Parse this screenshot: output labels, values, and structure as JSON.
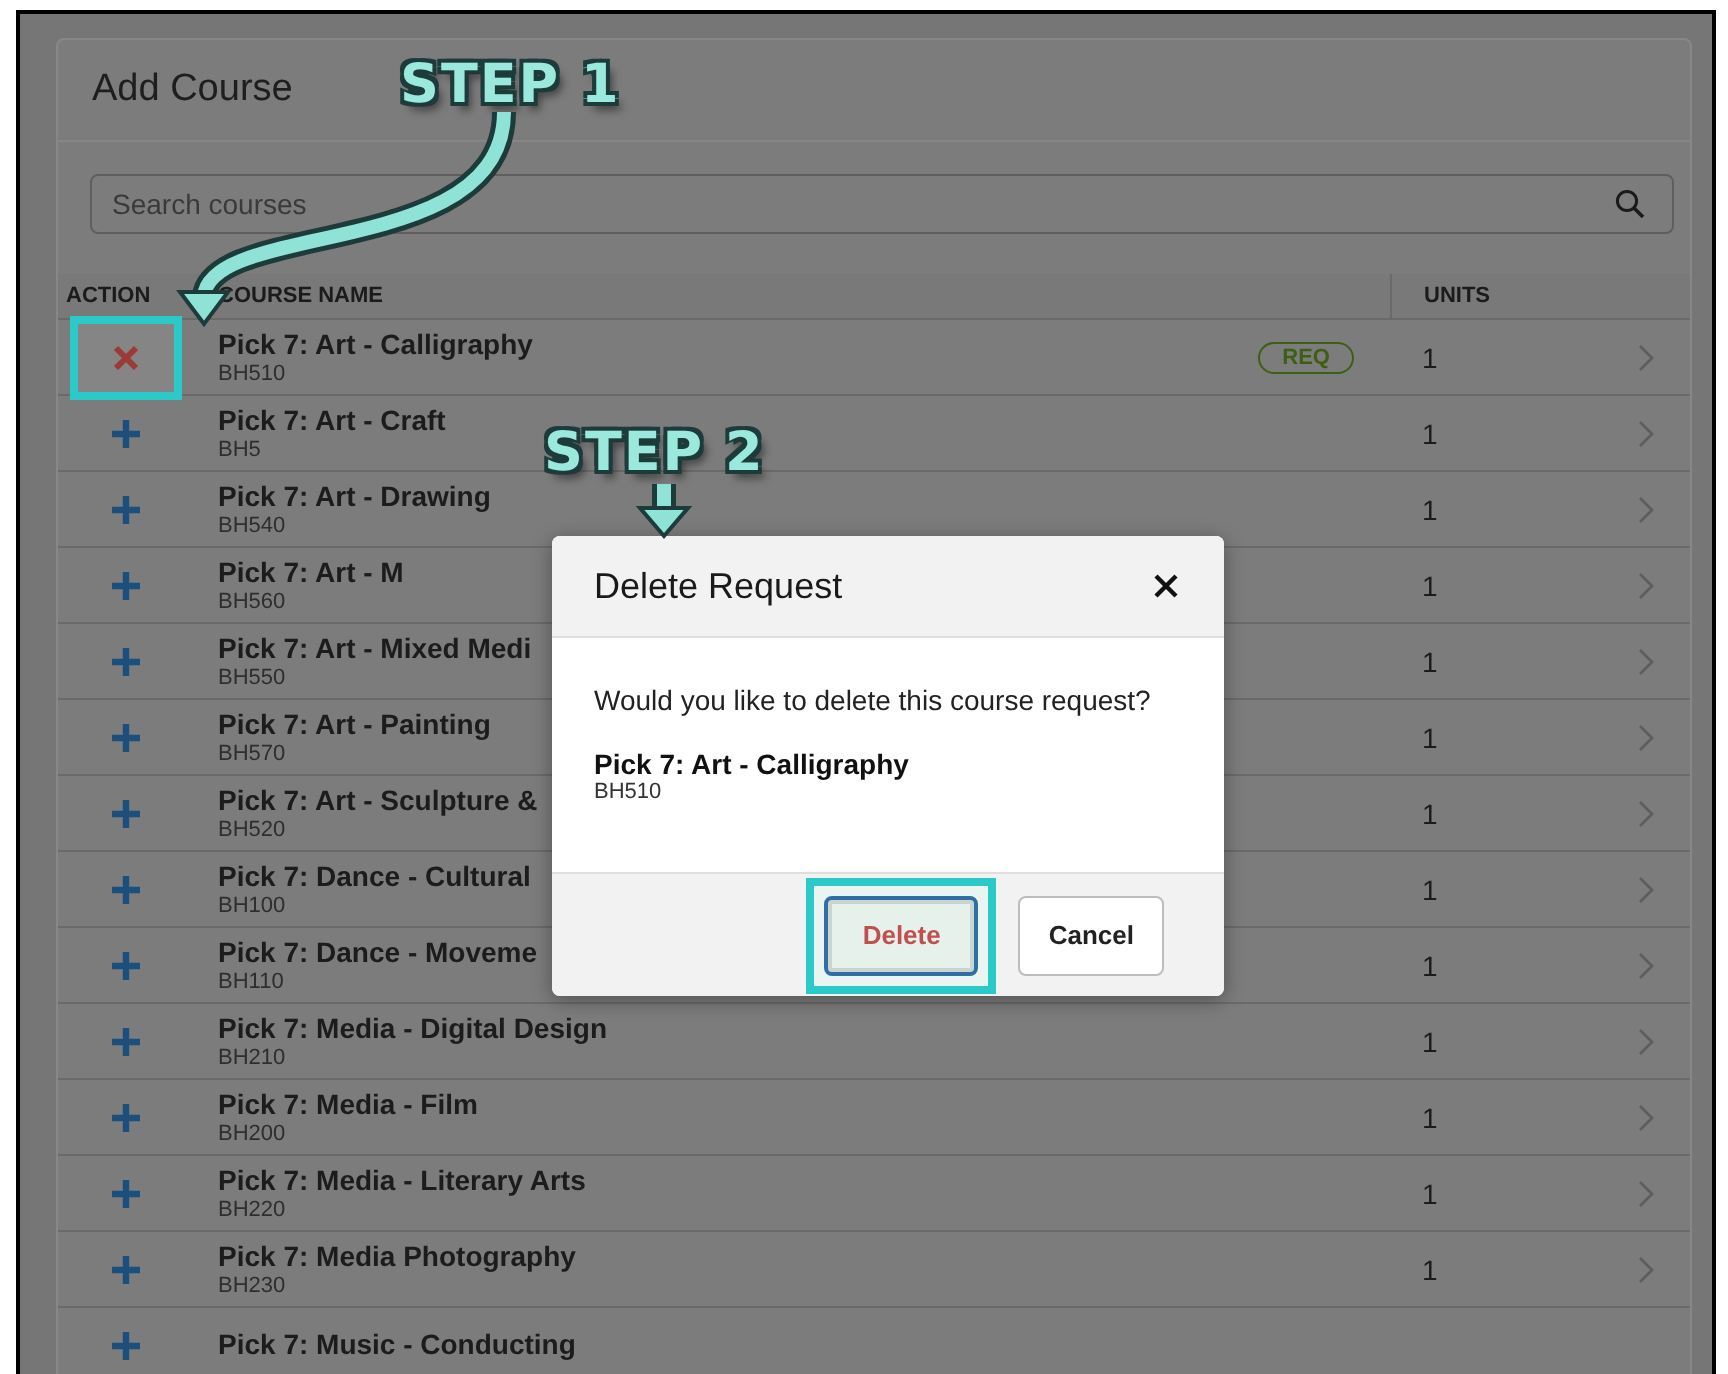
{
  "header": {
    "title": "Add Course"
  },
  "annotations": [
    {
      "kind": "step",
      "label": "STEP 1"
    },
    {
      "kind": "step",
      "label": "STEP 2"
    }
  ],
  "search": {
    "placeholder": "Search courses"
  },
  "table": {
    "columns": [
      "ACTION",
      "COURSE NAME",
      "UNITS"
    ],
    "rows": [
      {
        "kind": "remove",
        "highlighted": true,
        "name": "Pick 7: Art - Calligraphy",
        "code": "BH510",
        "required": true,
        "tag": "REQ",
        "units": "1"
      },
      {
        "kind": "add",
        "highlighted": false,
        "name": "Pick 7: Art - Craft",
        "code": "BH5",
        "required": false,
        "units": "1"
      },
      {
        "kind": "add",
        "highlighted": false,
        "name": "Pick 7: Art - Drawing",
        "code": "BH540",
        "required": false,
        "units": "1"
      },
      {
        "kind": "add",
        "highlighted": false,
        "name": "Pick 7: Art - M",
        "code": "BH560",
        "required": false,
        "units": "1"
      },
      {
        "kind": "add",
        "highlighted": false,
        "name": "Pick 7: Art - Mixed Medi",
        "code": "BH550",
        "required": false,
        "units": "1"
      },
      {
        "kind": "add",
        "highlighted": false,
        "name": "Pick 7: Art - Painting",
        "code": "BH570",
        "required": false,
        "units": "1"
      },
      {
        "kind": "add",
        "highlighted": false,
        "name": "Pick 7: Art - Sculpture &",
        "code": "BH520",
        "required": false,
        "units": "1"
      },
      {
        "kind": "add",
        "highlighted": false,
        "name": "Pick 7: Dance - Cultural",
        "code": "BH100",
        "required": false,
        "units": "1"
      },
      {
        "kind": "add",
        "highlighted": false,
        "name": "Pick 7: Dance - Moveme",
        "code": "BH110",
        "required": false,
        "units": "1"
      },
      {
        "kind": "add",
        "highlighted": false,
        "name": "Pick 7: Media - Digital Design",
        "code": "BH210",
        "required": false,
        "units": "1"
      },
      {
        "kind": "add",
        "highlighted": false,
        "name": "Pick 7: Media - Film",
        "code": "BH200",
        "required": false,
        "units": "1"
      },
      {
        "kind": "add",
        "highlighted": false,
        "name": "Pick 7: Media - Literary Arts",
        "code": "BH220",
        "required": false,
        "units": "1"
      },
      {
        "kind": "add",
        "highlighted": false,
        "name": "Pick 7: Media Photography",
        "code": "BH230",
        "required": false,
        "units": "1"
      },
      {
        "kind": "add",
        "highlighted": false,
        "name": "Pick 7: Music - Conducting",
        "required": false
      }
    ]
  },
  "dialog": {
    "title": "Delete Request",
    "message": "Would you like to delete this course request?",
    "course_name": "Pick 7: Art - Calligraphy",
    "course_code": "BH510",
    "buttons": [
      {
        "kind": "danger",
        "label": "Delete",
        "highlighted": true
      },
      {
        "kind": "default",
        "label": "Cancel",
        "highlighted": false
      }
    ]
  }
}
